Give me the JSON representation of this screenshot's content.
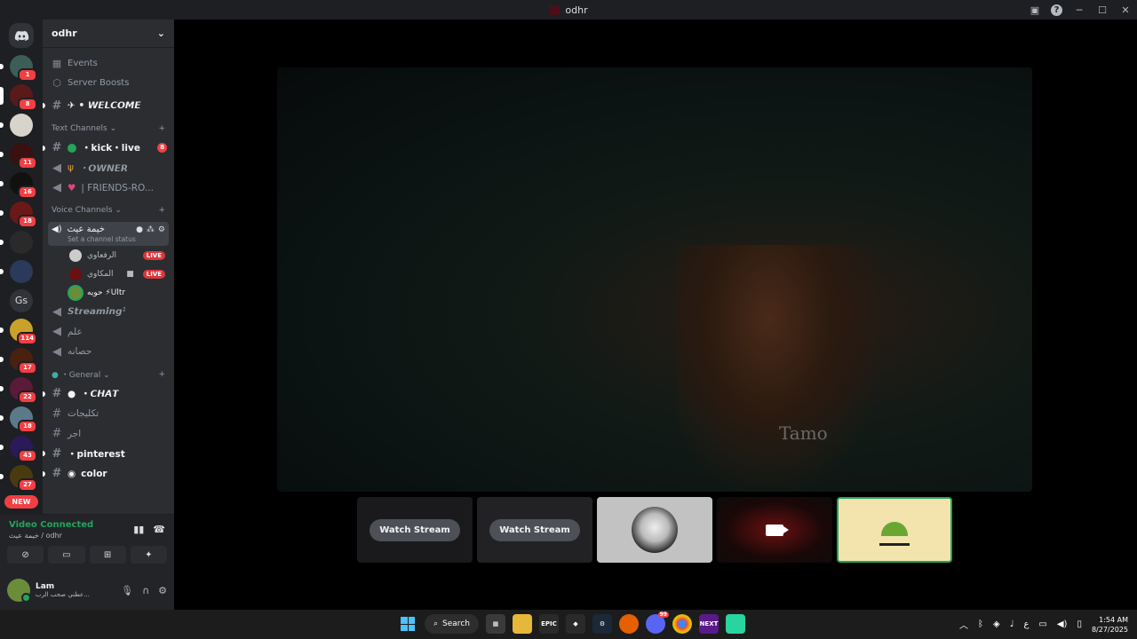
{
  "window": {
    "title": "odhr"
  },
  "guilds": {
    "badges": [
      "1",
      "8",
      "",
      "11",
      "16",
      "18",
      "",
      "",
      "",
      "114",
      "17",
      "22",
      "18",
      "43",
      "27",
      ""
    ],
    "text_guild": "Gs",
    "new_label": "NEW"
  },
  "server": {
    "name": "odhr",
    "events_label": "Events",
    "boosts_label": "Server Boosts",
    "welcome": "✈ • 𝙒𝙀𝙇𝘾𝙊𝙈𝙀",
    "text_category": "Text Channels",
    "text_channels": [
      {
        "name": "・kick・live",
        "mention": "8"
      },
      {
        "name": "・𝙊𝙒𝙉𝙀𝙍"
      },
      {
        "name": "| FRIENDS-RO..."
      }
    ],
    "voice_category": "Voice Channels",
    "active_voice": {
      "name": "خيمة عيث",
      "status": "Set a channel status"
    },
    "voice_users": [
      {
        "name": "الرفعاوي",
        "live": "LIVE"
      },
      {
        "name": "المكاوي",
        "live": "LIVE"
      },
      {
        "name": "حويه ⚡Ultr",
        "live": ""
      }
    ],
    "voice_channels": [
      "𝙎𝙩𝙧𝙚𝙖𝙢𝙞𝙣𝙜¹",
      "علم",
      "حصانه"
    ],
    "general_category": "・General",
    "general_channels": [
      "・𝘾𝙃𝘼𝙏",
      "تكليجات",
      "اجر",
      "・pinterest",
      "color"
    ]
  },
  "rtc": {
    "status": "Video Connected",
    "location": "خيمة عيث / odhr"
  },
  "user": {
    "name": "Lam",
    "status": "عطني صحب الرب..."
  },
  "stage": {
    "shirt_text": "Tamo",
    "watch_label_1": "Watch Stream",
    "watch_label_2": "Watch Stream"
  },
  "taskbar": {
    "search_label": "Search",
    "app_labels": [
      "EPIC",
      "NEXT"
    ],
    "discord_badge": "99",
    "ime": "ع",
    "time": "1:54 AM",
    "date": "8/27/2025"
  },
  "colors": {
    "online": "#23a55a",
    "danger": "#f23f43",
    "sidebar": "#2b2d31",
    "rail": "#1e1f22"
  }
}
